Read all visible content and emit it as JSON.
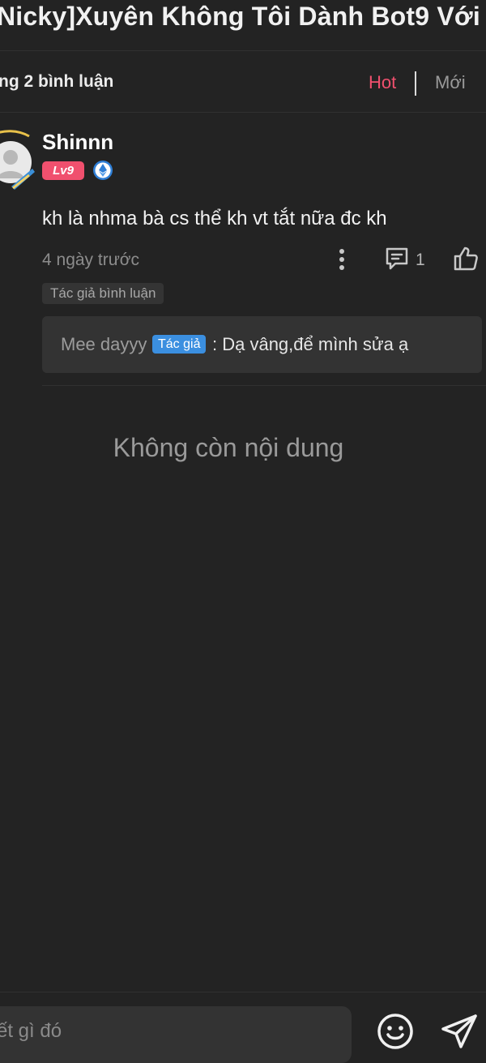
{
  "header": {
    "title": "Nicky]Xuyên Không Tôi Dành Bot9 Với T"
  },
  "comments_header": {
    "count_label": "ng 2 bình luận",
    "sort_hot": "Hot",
    "sort_new": "Mới"
  },
  "comment": {
    "username": "Shinnn",
    "level": "Lv9",
    "text": "kh là nhma bà cs thể kh vt tắt nữa đc kh",
    "timestamp": "4 ngày trước",
    "reply_count": "1",
    "author_tag": "Tác giả bình luận",
    "reply": {
      "author": "Mee dayyy",
      "badge": "Tác giả",
      "text": ": Dạ vâng,để mình sửa ạ"
    }
  },
  "empty_state": "Không còn nội dung",
  "composer": {
    "placeholder": "ết gì đó"
  },
  "colors": {
    "accent": "#f0506e",
    "badge_blue": "#3b8fe0",
    "background": "#232323"
  }
}
